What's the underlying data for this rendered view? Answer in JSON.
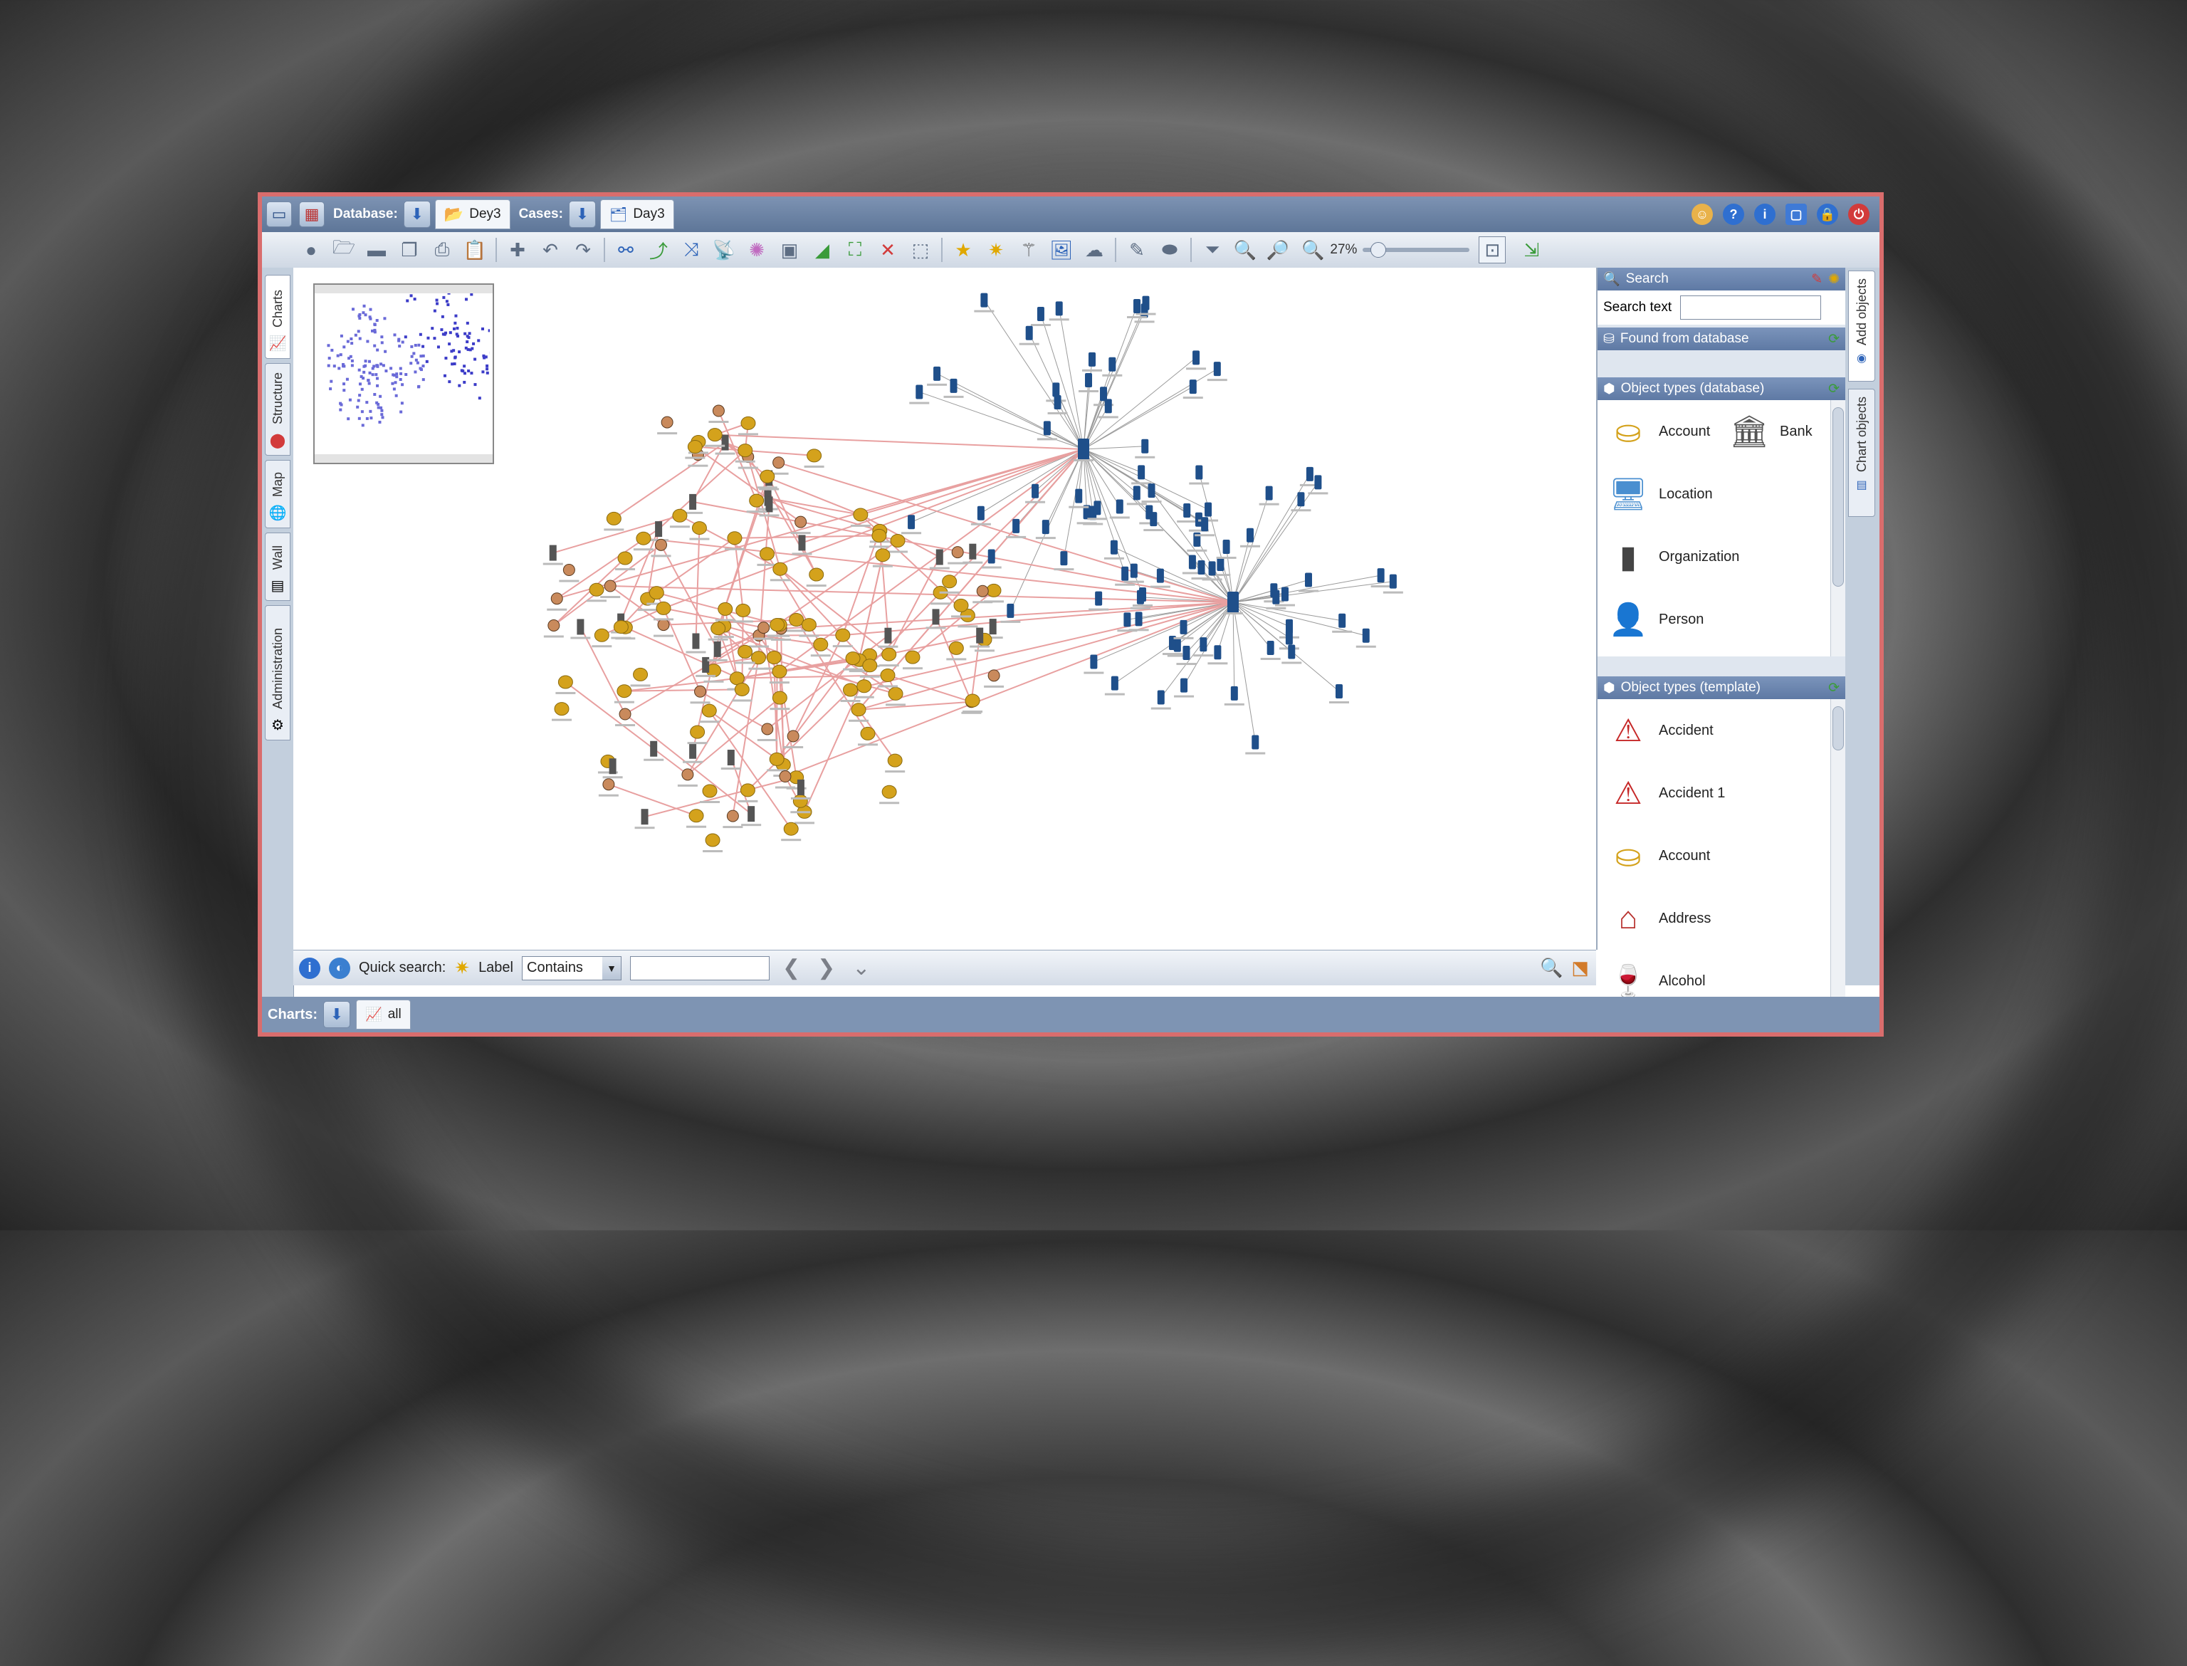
{
  "titlebar": {
    "database_label": "Database:",
    "database_tab": "Dey3",
    "cases_label": "Cases:",
    "cases_tab": "Day3"
  },
  "toolbar": {
    "zoom_value": "27%",
    "zoom_level": 0.27
  },
  "left_tabs": [
    "Charts",
    "Structure",
    "Map",
    "Wall",
    "Administration"
  ],
  "quick_search": {
    "label": "Quick search:",
    "field_label": "Label",
    "operator": "Contains",
    "value": ""
  },
  "charts_bar": {
    "label": "Charts:",
    "tab": "all"
  },
  "right_panel": {
    "search_header": "Search",
    "search_text_label": "Search text",
    "search_value": "",
    "found_header": "Found from database",
    "db_types_header": "Object types (database)",
    "db_types": [
      {
        "label": "Account",
        "icon": "coins-icon"
      },
      {
        "label": "Bank",
        "icon": "bank-icon"
      },
      {
        "label": "Location",
        "icon": "location-icon"
      },
      {
        "label": "Organization",
        "icon": "organization-icon"
      },
      {
        "label": "Person",
        "icon": "person-icon"
      }
    ],
    "template_types_header": "Object types (template)",
    "template_types": [
      {
        "label": "Accident",
        "icon": "warning-icon"
      },
      {
        "label": "Accident 1",
        "icon": "warning-icon"
      },
      {
        "label": "Account",
        "icon": "coins-icon"
      },
      {
        "label": "Address",
        "icon": "house-icon"
      },
      {
        "label": "Alcohol",
        "icon": "wine-glasses-icon"
      }
    ]
  },
  "right_tabs": [
    "Add objects",
    "Chart objects"
  ],
  "colors": {
    "frame_border": "#d96d6d",
    "title_bar": "#6b84a8",
    "panel_header": "#6a84ae",
    "link_line": "#e8a0a0",
    "phone_node": "#1f4f8a",
    "account_node": "#d4a21c"
  }
}
